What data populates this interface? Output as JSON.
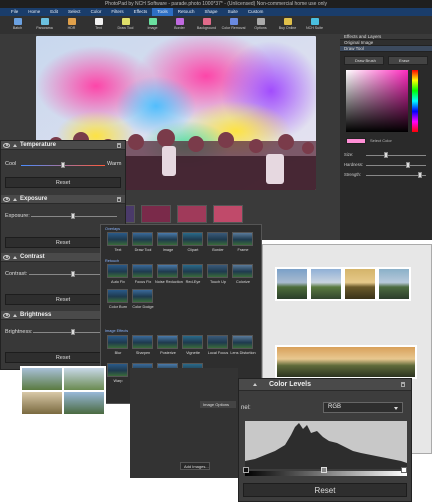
{
  "window": {
    "title": "PhotoPad by NCH Software - parade.photo 1000*37* - (Unlicensed) Non-commercial home use only"
  },
  "menu": [
    "File",
    "Home",
    "Edit",
    "Select",
    "Color",
    "Filters",
    "Effects",
    "Tools",
    "Retouch",
    "Shape",
    "Suite",
    "Custom"
  ],
  "menu_active": "Tools",
  "toolbar": [
    "Batch",
    "Panorama",
    "HDR",
    "Text",
    "Draw Tool",
    "Image",
    "Border",
    "Background",
    "Color Removal",
    "Options",
    "Buy Online",
    "NCH Suite"
  ],
  "right_panel": {
    "header": "Effects and Layers",
    "layer1": "Original Image",
    "layer2": "Draw Tool",
    "draw_btn": "Draw Brush",
    "erase_btn": "Erase",
    "select_color": "Select Color",
    "size": "Size:",
    "hardness": "Hardness:",
    "strength": "Strength:"
  },
  "temperature": {
    "title": "Temperature",
    "cool": "Cool",
    "warm": "Warm",
    "reset": "Reset"
  },
  "exposure": {
    "title": "Exposure",
    "label": "Exposure:",
    "reset": "Reset"
  },
  "contrast": {
    "title": "Contrast",
    "label": "Contrast:",
    "reset": "Reset"
  },
  "brightness": {
    "title": "Brightness",
    "label": "Brightness:",
    "reset": "Reset"
  },
  "effects_panel": {
    "group1": "Overlays",
    "row1": [
      "Text",
      "Draw Tool",
      "Image",
      "Clipart",
      "Border",
      "Frame"
    ],
    "group2": "Retouch",
    "row2": [
      "Auto Fix",
      "Focus Fix",
      "Noise Reduction",
      "Red-Eye",
      "Touch Up",
      "Colorize"
    ],
    "row3": [
      "Color Burn",
      "Color Dodge"
    ],
    "group3": "Image Effects",
    "row4": [
      "Blur",
      "Sharpen",
      "Posterize",
      "Vignette",
      "Local Focus",
      "Lens Distortion"
    ],
    "row5": [
      "Warp",
      "Green Screen",
      "Double Exposure",
      "TrueTone"
    ]
  },
  "color_levels": {
    "title": "Color Levels",
    "channel_label": "nel:",
    "channel_value": "RGB",
    "reset": "Reset"
  },
  "misc": {
    "image_options": "Image Options",
    "add_images": "Add Images..."
  },
  "colors": {
    "menu_bg": "#1a3d6b",
    "panel_dark": "#2c2c2c",
    "accent_blue": "#2d6fc4"
  }
}
